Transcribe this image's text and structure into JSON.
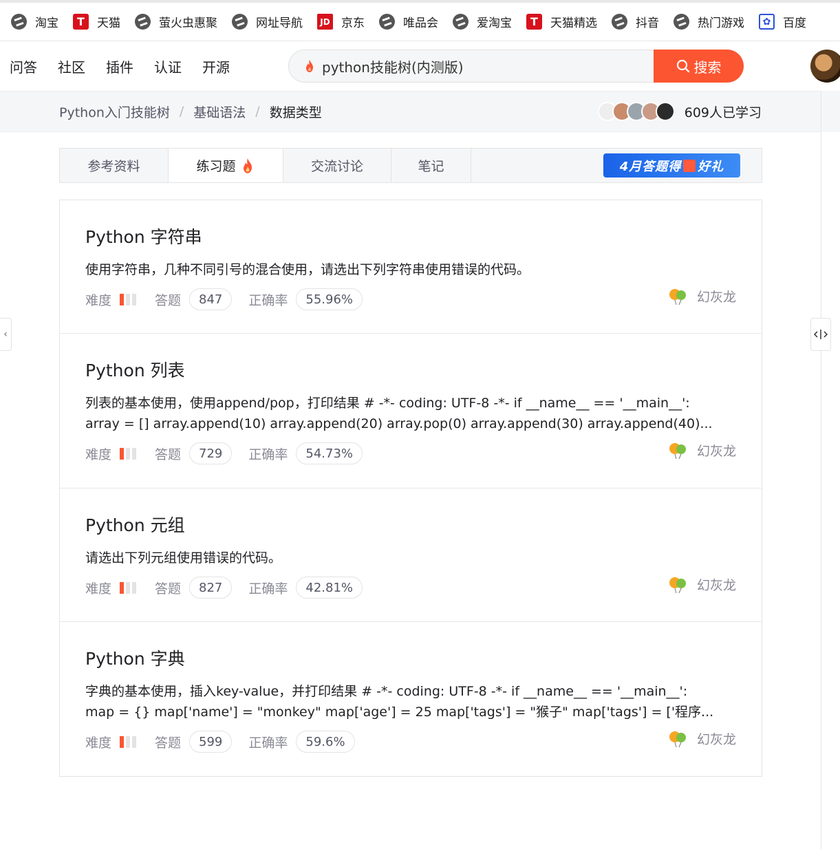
{
  "bookmarks": [
    {
      "label": "淘宝",
      "icon": "e-browser-icon"
    },
    {
      "label": "天猫",
      "icon": "tmall-icon"
    },
    {
      "label": "萤火虫惠聚",
      "icon": "e-browser-icon"
    },
    {
      "label": "网址导航",
      "icon": "e-browser-icon"
    },
    {
      "label": "京东",
      "icon": "jd-icon"
    },
    {
      "label": "唯品会",
      "icon": "e-browser-icon"
    },
    {
      "label": "爱淘宝",
      "icon": "e-browser-icon"
    },
    {
      "label": "天猫精选",
      "icon": "tmall-icon"
    },
    {
      "label": "抖音",
      "icon": "e-browser-icon"
    },
    {
      "label": "热门游戏",
      "icon": "e-browser-icon"
    },
    {
      "label": "百度",
      "icon": "baidu-paw-icon"
    }
  ],
  "nav": {
    "links": [
      "问答",
      "社区",
      "插件",
      "认证",
      "开源"
    ],
    "search_value": "python技能树(内测版)",
    "search_button": "搜索"
  },
  "breadcrumb": [
    "Python入门技能树",
    "基础语法",
    "数据类型"
  ],
  "learners": "609人已学习",
  "tabs": [
    "参考资料",
    "练习题",
    "交流讨论",
    "笔记"
  ],
  "promo": {
    "left": "4月答题得",
    "right": "好礼"
  },
  "labels": {
    "difficulty": "难度",
    "answers": "答题",
    "accuracy": "正确率"
  },
  "exercises": [
    {
      "title": "Python 字符串",
      "desc": [
        "使用字符串，几种不同引号的混合使用，请选出下列字符串使用错误的代码。"
      ],
      "difficulty_level": 1,
      "answers": "847",
      "accuracy": "55.96%",
      "author": "幻灰龙"
    },
    {
      "title": "Python 列表",
      "desc": [
        "列表的基本使用，使用append/pop，打印结果 # -*- coding: UTF-8 -*- if __name__ == '__main__':",
        "array = [] array.append(10) array.append(20) array.pop(0) array.append(30) array.append(40)..."
      ],
      "difficulty_level": 1,
      "answers": "729",
      "accuracy": "54.73%",
      "author": "幻灰龙"
    },
    {
      "title": "Python 元组",
      "desc": [
        "请选出下列元组使用错误的代码。"
      ],
      "difficulty_level": 1,
      "answers": "827",
      "accuracy": "42.81%",
      "author": "幻灰龙"
    },
    {
      "title": "Python 字典",
      "desc": [
        "字典的基本使用，插入key-value，并打印结果 # -*- coding: UTF-8 -*- if __name__ == '__main__':",
        "map = {} map['name'] = \"monkey\" map['age'] = 25 map['tags'] = \"猴子\" map['tags'] = ['程序..."
      ],
      "difficulty_level": 1,
      "answers": "599",
      "accuracy": "59.6%",
      "author": "幻灰龙"
    }
  ],
  "colors": {
    "accent": "#fc5531",
    "promo": "#1a63e8"
  }
}
